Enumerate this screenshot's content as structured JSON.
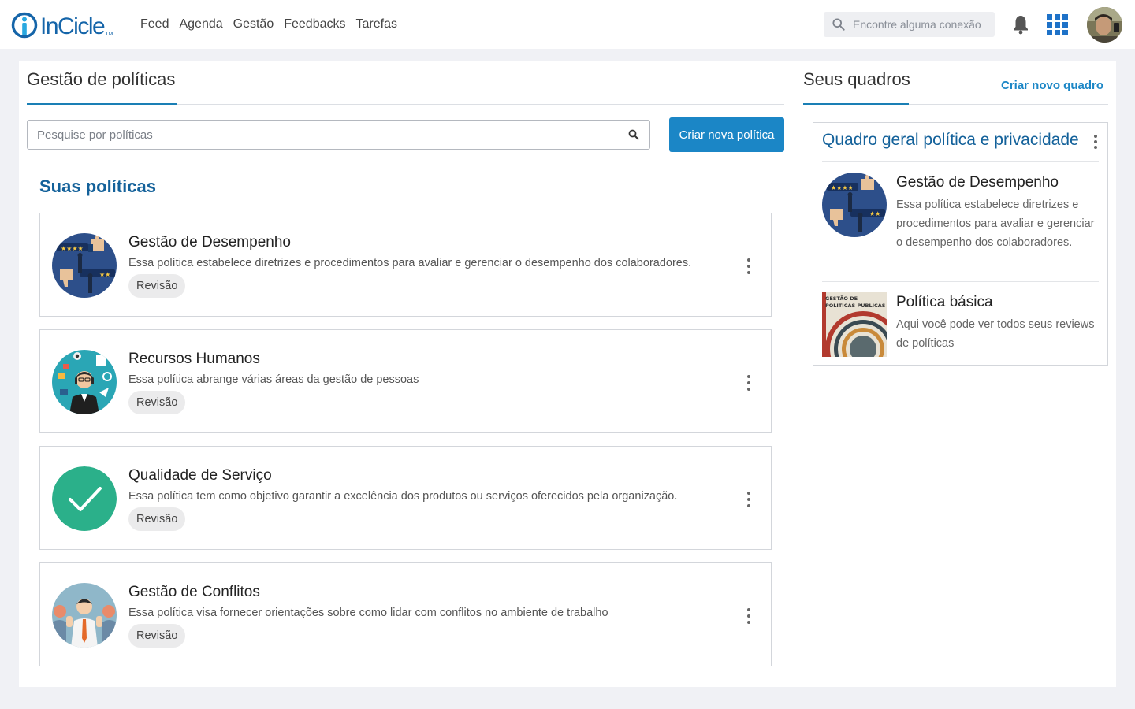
{
  "header": {
    "logo_text": "InCicle",
    "logo_tm": "TM",
    "nav": [
      "Feed",
      "Agenda",
      "Gestão",
      "Feedbacks",
      "Tarefas"
    ],
    "search_placeholder": "Encontre alguma conexão"
  },
  "left": {
    "title": "Gestão de políticas",
    "search_placeholder": "Pesquise por políticas",
    "create_button": "Criar nova política",
    "section_heading": "Suas políticas",
    "policies": [
      {
        "title": "Gestão de Desempenho",
        "description": "Essa política estabelece diretrizes e procedimentos para avaliar e gerenciar o desempenho dos colaboradores.",
        "status": "Revisão"
      },
      {
        "title": "Recursos Humanos",
        "description": "Essa política abrange várias áreas da gestão de pessoas",
        "status": "Revisão"
      },
      {
        "title": "Qualidade de Serviço",
        "description": "Essa política tem como objetivo garantir a excelência dos produtos ou serviços oferecidos pela organização.",
        "status": "Revisão"
      },
      {
        "title": "Gestão de Conflitos",
        "description": "Essa política visa fornecer orientações sobre como lidar com conflitos no ambiente de trabalho",
        "status": "Revisão"
      }
    ]
  },
  "right": {
    "title": "Seus quadros",
    "create_link": "Criar novo quadro",
    "board": {
      "title": "Quadro geral política e privacidade",
      "items": [
        {
          "title": "Gestão de Desempenho",
          "description": "Essa política estabelece diretrizes e procedimentos para avaliar e gerenciar o desempenho dos colaboradores."
        },
        {
          "title": "Política básica",
          "description": "Aqui você pode ver todos seus reviews de políticas"
        }
      ]
    }
  },
  "book_cover": {
    "line1": "GESTÃO DE",
    "line2": "POLÍTICAS PÚBLICAS"
  },
  "colors": {
    "brand": "#1565a9",
    "primary_button": "#1b86c6",
    "heading_blue": "#13619a",
    "check_green": "#2bb08a"
  }
}
